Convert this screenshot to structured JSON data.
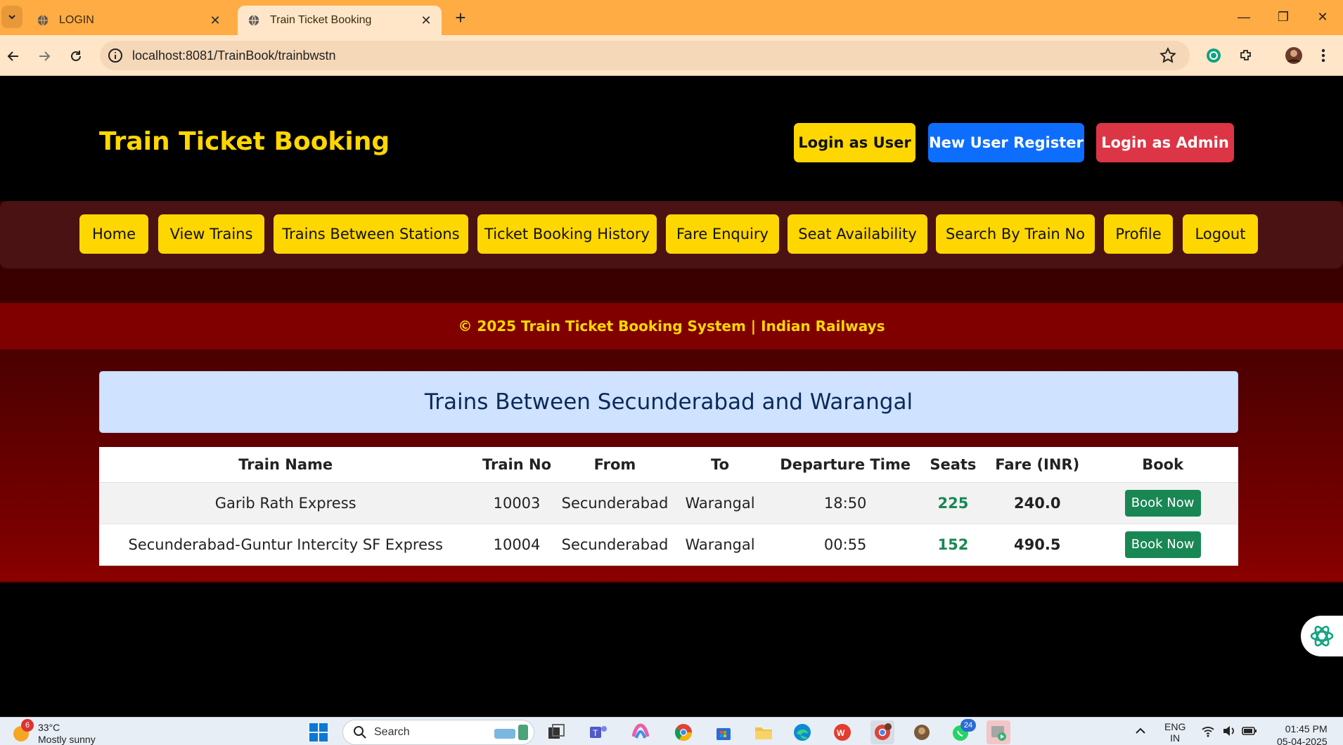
{
  "browser": {
    "tabs": [
      {
        "title": "LOGIN",
        "active": false
      },
      {
        "title": "Train Ticket Booking",
        "active": true
      }
    ],
    "url": "localhost:8081/TrainBook/trainbwstn"
  },
  "header": {
    "brand": "Train Ticket Booking",
    "buttons": {
      "login_user": "Login as User",
      "register": "New User Register",
      "login_admin": "Login as Admin"
    }
  },
  "menu": [
    "Home",
    "View Trains",
    "Trains Between Stations",
    "Ticket Booking History",
    "Fare Enquiry",
    "Seat Availability",
    "Search By Train No",
    "Profile",
    "Logout"
  ],
  "footer": "© 2025 Train Ticket Booking System | Indian Railways",
  "results": {
    "title": "Trains Between Secunderabad and Warangal",
    "columns": [
      "Train Name",
      "Train No",
      "From",
      "To",
      "Departure Time",
      "Seats",
      "Fare (INR)",
      "Book"
    ],
    "rows": [
      {
        "name": "Garib Rath Express",
        "no": "10003",
        "from": "Secunderabad",
        "to": "Warangal",
        "departure": "18:50",
        "seats": "225",
        "fare": "240.0",
        "book": "Book Now"
      },
      {
        "name": "Secunderabad-Guntur Intercity SF Express",
        "no": "10004",
        "from": "Secunderabad",
        "to": "Warangal",
        "departure": "00:55",
        "seats": "152",
        "fare": "490.5",
        "book": "Book Now"
      }
    ]
  },
  "taskbar": {
    "weather": {
      "temp": "33°C",
      "condition": "Mostly sunny",
      "badge": "6"
    },
    "search_placeholder": "Search",
    "lang": "ENG",
    "lang_sub": "IN",
    "time": "01:45 PM",
    "date": "05-04-2025",
    "whatsapp_badge": "24"
  },
  "colors": {
    "brand_yellow": "#ffd700",
    "register_blue": "#0d6efd",
    "admin_red": "#dc3545",
    "book_green": "#198754",
    "title_box": "#cfe2ff"
  }
}
